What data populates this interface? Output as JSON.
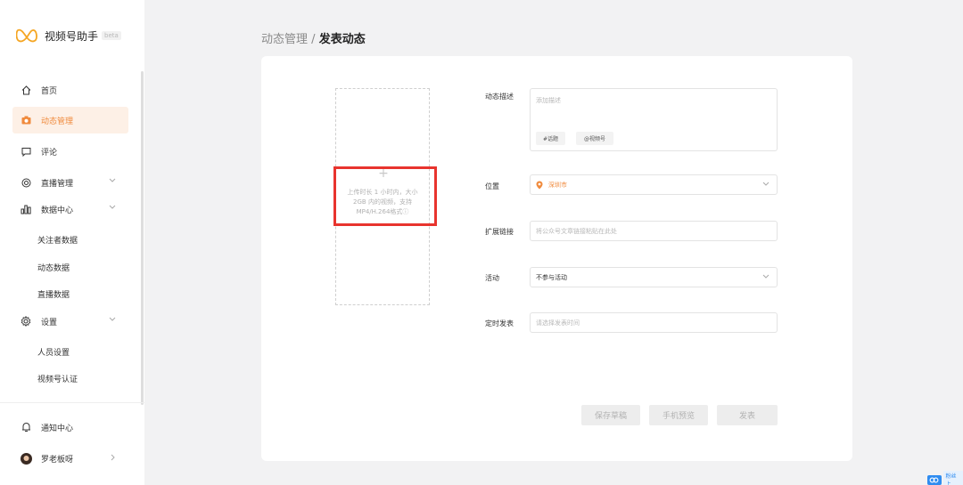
{
  "sidebar": {
    "brand": {
      "name": "视频号助手",
      "badge": "beta"
    },
    "items": [
      {
        "label": "首页",
        "icon": "home-icon"
      },
      {
        "label": "动态管理",
        "icon": "camera-icon",
        "active": true
      },
      {
        "label": "评论",
        "icon": "comment-icon"
      },
      {
        "label": "直播管理",
        "icon": "live-icon"
      },
      {
        "label": "数据中心",
        "icon": "chart-icon"
      }
    ],
    "data_sub": [
      "关注者数据",
      "动态数据",
      "直播数据"
    ],
    "settings": {
      "label": "设置",
      "icon": "gear-icon"
    },
    "settings_sub": [
      "人员设置",
      "视频号认证"
    ],
    "notify": {
      "label": "通知中心",
      "icon": "bell-icon"
    },
    "user": {
      "name": "罗老板呀"
    }
  },
  "breadcrumb": {
    "parent": "动态管理",
    "separator": "/",
    "current": "发表动态"
  },
  "upload": {
    "plus": "+",
    "hint": "上传时长 1 小时内，大小 2GB 内的视频，支持MP4/H.264格式ⓘ"
  },
  "form": {
    "desc_label": "动态描述",
    "desc_placeholder": "添加描述",
    "tag_topic": "#话题",
    "tag_account": "@视频号",
    "location_label": "位置",
    "location_value": "深圳市",
    "link_label": "扩展链接",
    "link_placeholder": "将公众号文章链接粘贴在此处",
    "activity_label": "活动",
    "activity_value": "不参与活动",
    "schedule_label": "定时发表",
    "schedule_placeholder": "请选择发表时间"
  },
  "actions": {
    "save": "保存草稿",
    "preview": "手机预览",
    "publish": "发表"
  },
  "corner": {
    "text": "粉丝上"
  },
  "colors": {
    "accent": "#f08a3c",
    "highlight": "#e8342e",
    "active_bg": "#fdf0e6"
  }
}
